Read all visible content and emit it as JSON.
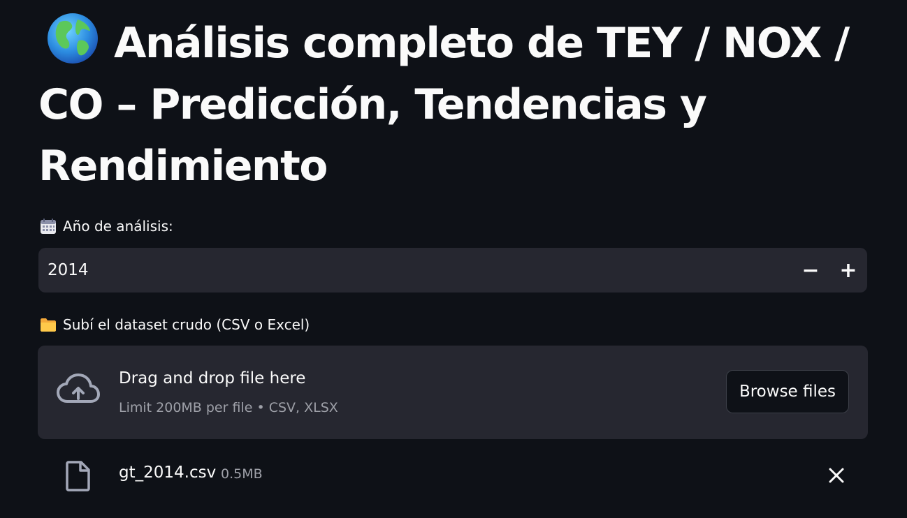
{
  "page": {
    "title": "Análisis completo de TEY / NOX / CO – Predicción, Tendencias y Rendimiento",
    "title_icon": "globe-icon"
  },
  "year_input": {
    "label": "Año de análisis:",
    "label_icon": "calendar-icon",
    "value": "2014",
    "decrement_label": "−",
    "increment_label": "+"
  },
  "uploader": {
    "label": "Subí el dataset crudo (CSV o Excel)",
    "label_icon": "folder-icon",
    "drop_text": "Drag and drop file here",
    "limit_text": "Limit 200MB per file • CSV, XLSX",
    "browse_label": "Browse files",
    "upload_icon": "cloud-upload-icon"
  },
  "uploaded_file": {
    "name": "gt_2014.csv",
    "size": "0.5MB",
    "file_icon": "file-icon",
    "remove_icon": "close-icon"
  },
  "colors": {
    "background": "#0e1117",
    "widget_bg": "#262730",
    "text": "#fafafa",
    "muted_text": "#9ea0a8"
  }
}
